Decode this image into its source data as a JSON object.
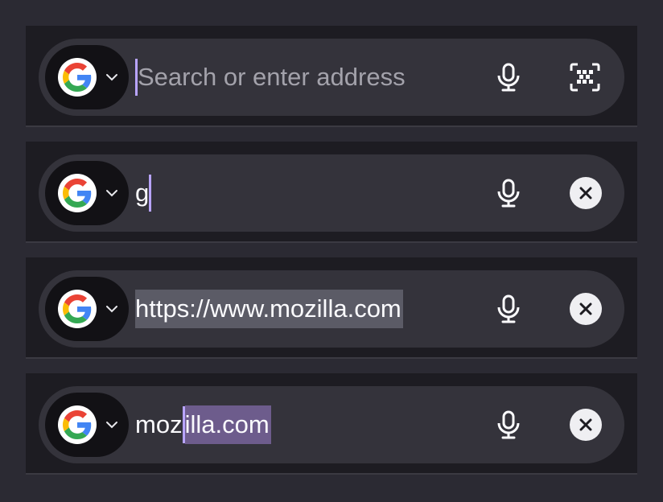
{
  "rows": [
    {
      "engine": {
        "icon": "google-icon",
        "menu_icon": "chevron-down-icon"
      },
      "input": {
        "value": "",
        "placeholder": "Search or enter address"
      },
      "actions": [
        "microphone-icon",
        "qr-code-icon"
      ]
    },
    {
      "engine": {
        "icon": "google-icon",
        "menu_icon": "chevron-down-icon"
      },
      "input": {
        "value": "g"
      },
      "actions": [
        "microphone-icon",
        "clear-icon"
      ]
    },
    {
      "engine": {
        "icon": "google-icon",
        "menu_icon": "chevron-down-icon"
      },
      "input": {
        "value": "https://www.mozilla.com",
        "selected": "https://www.mozilla.com"
      },
      "actions": [
        "microphone-icon",
        "clear-icon"
      ]
    },
    {
      "engine": {
        "icon": "google-icon",
        "menu_icon": "chevron-down-icon"
      },
      "input": {
        "typed": "moz",
        "suggested": "illa.com",
        "value": "mozilla.com"
      },
      "actions": [
        "microphone-icon",
        "clear-icon"
      ]
    }
  ],
  "colors": {
    "page_bg": "#2b2a33",
    "panel_bg": "#1d1c22",
    "bar_bg": "#34333b",
    "engine_bg": "#121115",
    "caret": "#b8a4ff",
    "selection_full": "#5b5b66",
    "selection_autocomplete": "#6d5c8c",
    "text": "#fbfbfe",
    "placeholder": "#a3a2ab"
  }
}
